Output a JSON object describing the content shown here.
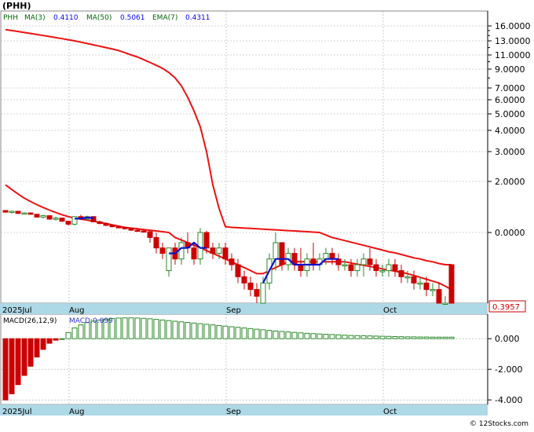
{
  "title": "(PHH)",
  "legend": {
    "symbol": "PHH",
    "items": [
      {
        "label": "MA(3)",
        "value": "0.4110",
        "color": "#0000ff"
      },
      {
        "label": "MA(50)",
        "value": "0.5061",
        "color": "#ff0000"
      },
      {
        "label": "EMA(7)",
        "value": "0.4311",
        "color": "#ff0000"
      }
    ]
  },
  "macd_legend": {
    "label": "MACD(26,12,9)",
    "value_label": "MACD:0.099",
    "value_color": "#3333cc"
  },
  "last_price_badge": "0.3957",
  "watermark": "© 12Stocks.com",
  "colors": {
    "up": "#2a8a2a",
    "down": "#cc0000",
    "ma": "#ee1111",
    "ma_short": "#1111cc",
    "axis_band": "#add8e6",
    "grid": "#aaaaaa"
  },
  "chart_data": [
    {
      "type": "line",
      "panel": "price",
      "scale": "log",
      "y_axis_labels": [
        "16.0000",
        "13.0000",
        "11.0000",
        "9.0000",
        "7.0000",
        "6.0000",
        "5.0000",
        "4.0000",
        "3.0000",
        "2.0000",
        "0.0000"
      ],
      "x_tick_labels": [
        "2025Jul",
        "Aug",
        "Sep",
        "Oct"
      ],
      "x_index_of_ticks": [
        0,
        10,
        35,
        60
      ],
      "n_days": 72,
      "ohlc": [
        [
          0.8,
          0.81,
          0.74,
          0.76
        ],
        [
          0.76,
          0.8,
          0.73,
          0.78
        ],
        [
          0.78,
          0.78,
          0.72,
          0.73
        ],
        [
          0.73,
          0.76,
          0.71,
          0.74
        ],
        [
          0.74,
          0.76,
          0.7,
          0.71
        ],
        [
          0.71,
          0.72,
          0.64,
          0.65
        ],
        [
          0.65,
          0.7,
          0.62,
          0.68
        ],
        [
          0.68,
          0.68,
          0.6,
          0.61
        ],
        [
          0.61,
          0.66,
          0.58,
          0.63
        ],
        [
          0.63,
          0.63,
          0.56,
          0.57
        ],
        [
          0.57,
          0.58,
          0.5,
          0.52
        ],
        [
          0.52,
          0.66,
          0.5,
          0.66
        ],
        [
          0.66,
          0.7,
          0.6,
          0.61
        ],
        [
          0.61,
          0.68,
          0.58,
          0.66
        ],
        [
          0.66,
          0.66,
          0.55,
          0.56
        ],
        [
          0.56,
          0.58,
          0.52,
          0.53
        ],
        [
          0.53,
          0.55,
          0.49,
          0.5
        ],
        [
          0.5,
          0.51,
          0.47,
          0.48
        ],
        [
          0.48,
          0.5,
          0.46,
          0.47
        ],
        [
          0.47,
          0.48,
          0.44,
          0.45
        ],
        [
          0.45,
          0.46,
          0.42,
          0.43
        ],
        [
          0.43,
          0.45,
          0.41,
          0.42
        ],
        [
          0.42,
          0.44,
          0.4,
          0.41
        ],
        [
          0.41,
          0.42,
          0.38,
          0.39
        ],
        [
          0.39,
          0.4,
          0.36,
          0.37
        ],
        [
          0.37,
          0.38,
          0.35,
          0.36
        ],
        [
          0.33,
          0.37,
          0.32,
          0.37
        ],
        [
          0.37,
          0.38,
          0.34,
          0.35
        ],
        [
          0.35,
          0.39,
          0.34,
          0.38
        ],
        [
          0.38,
          0.4,
          0.36,
          0.37
        ],
        [
          0.37,
          0.38,
          0.34,
          0.35
        ],
        [
          0.35,
          0.46,
          0.34,
          0.4
        ],
        [
          0.4,
          0.42,
          0.36,
          0.37
        ],
        [
          0.37,
          0.38,
          0.35,
          0.36
        ],
        [
          0.36,
          0.38,
          0.35,
          0.37
        ],
        [
          0.37,
          0.38,
          0.34,
          0.35
        ],
        [
          0.35,
          0.36,
          0.33,
          0.34
        ],
        [
          0.34,
          0.35,
          0.31,
          0.32
        ],
        [
          0.32,
          0.33,
          0.3,
          0.31
        ],
        [
          0.31,
          0.32,
          0.29,
          0.3
        ],
        [
          0.3,
          0.31,
          0.28,
          0.29
        ],
        [
          0.28,
          0.32,
          0.27,
          0.31
        ],
        [
          0.31,
          0.36,
          0.3,
          0.35
        ],
        [
          0.35,
          0.4,
          0.33,
          0.38
        ],
        [
          0.38,
          0.38,
          0.33,
          0.34
        ],
        [
          0.34,
          0.37,
          0.33,
          0.36
        ],
        [
          0.36,
          0.37,
          0.33,
          0.34
        ],
        [
          0.34,
          0.37,
          0.32,
          0.33
        ],
        [
          0.33,
          0.36,
          0.32,
          0.35
        ],
        [
          0.35,
          0.38,
          0.33,
          0.34
        ],
        [
          0.34,
          0.36,
          0.33,
          0.35
        ],
        [
          0.35,
          0.37,
          0.34,
          0.36
        ],
        [
          0.36,
          0.37,
          0.34,
          0.35
        ],
        [
          0.35,
          0.36,
          0.33,
          0.34
        ],
        [
          0.34,
          0.35,
          0.33,
          0.34
        ],
        [
          0.34,
          0.35,
          0.32,
          0.33
        ],
        [
          0.33,
          0.35,
          0.32,
          0.34
        ],
        [
          0.34,
          0.36,
          0.32,
          0.35
        ],
        [
          0.35,
          0.37,
          0.33,
          0.34
        ],
        [
          0.34,
          0.35,
          0.32,
          0.33
        ],
        [
          0.33,
          0.34,
          0.32,
          0.33
        ],
        [
          0.33,
          0.35,
          0.32,
          0.34
        ],
        [
          0.34,
          0.35,
          0.32,
          0.33
        ],
        [
          0.33,
          0.34,
          0.31,
          0.32
        ],
        [
          0.32,
          0.33,
          0.31,
          0.32
        ],
        [
          0.32,
          0.33,
          0.3,
          0.31
        ],
        [
          0.31,
          0.32,
          0.3,
          0.31
        ],
        [
          0.31,
          0.32,
          0.29,
          0.3
        ],
        [
          0.3,
          0.31,
          0.29,
          0.3
        ],
        [
          0.3,
          0.31,
          0.28,
          0.28
        ],
        [
          0.27,
          0.29,
          0.27,
          0.28
        ],
        [
          0.34,
          0.34,
          0.27,
          0.28
        ]
      ],
      "series": [
        {
          "name": "MA(50)",
          "color": "#ee1111",
          "values": [
            15.2,
            15.0,
            14.8,
            14.6,
            14.4,
            14.2,
            14.0,
            13.8,
            13.6,
            13.4,
            13.2,
            13.0,
            12.8,
            12.6,
            12.4,
            12.2,
            12.0,
            11.8,
            11.6,
            11.3,
            11.0,
            10.7,
            10.3,
            9.9,
            9.5,
            9.1,
            8.6,
            8.0,
            7.2,
            6.2,
            5.2,
            4.2,
            3.0,
            1.8,
            0.85,
            0.48,
            0.47,
            0.465,
            0.46,
            0.455,
            0.45,
            0.445,
            0.44,
            0.435,
            0.43,
            0.425,
            0.42,
            0.415,
            0.41,
            0.405,
            0.4,
            0.395,
            0.39,
            0.387,
            0.384,
            0.381,
            0.378,
            0.375,
            0.372,
            0.369,
            0.366,
            0.363,
            0.361,
            0.358,
            0.355,
            0.352,
            0.35,
            0.347,
            0.345,
            0.342,
            0.34,
            0.34
          ]
        },
        {
          "name": "EMA(7)",
          "color": "#ee1111",
          "values": [
            1.8,
            1.55,
            1.35,
            1.18,
            1.06,
            0.96,
            0.88,
            0.81,
            0.75,
            0.7,
            0.66,
            0.63,
            0.61,
            0.59,
            0.57,
            0.55,
            0.53,
            0.51,
            0.49,
            0.47,
            0.46,
            0.45,
            0.44,
            0.43,
            0.42,
            0.41,
            0.4,
            0.39,
            0.385,
            0.38,
            0.375,
            0.37,
            0.365,
            0.36,
            0.355,
            0.35,
            0.345,
            0.34,
            0.335,
            0.33,
            0.325,
            0.325,
            0.33,
            0.335,
            0.34,
            0.345,
            0.345,
            0.345,
            0.345,
            0.345,
            0.345,
            0.345,
            0.345,
            0.345,
            0.345,
            0.343,
            0.341,
            0.339,
            0.337,
            0.335,
            0.333,
            0.331,
            0.329,
            0.327,
            0.325,
            0.322,
            0.319,
            0.316,
            0.313,
            0.31,
            0.305,
            0.3
          ]
        },
        {
          "name": "MA(3)",
          "color": "#1111cc",
          "points_index": [
            11,
            12,
            13,
            14
          ],
          "values_blue": [
            0.62,
            0.62,
            0.64,
            0.63
          ]
        }
      ],
      "ma3_segments": [
        {
          "start": 11,
          "values": [
            0.62,
            0.62,
            0.64,
            0.63
          ]
        },
        {
          "start": 26,
          "values": [
            0.36,
            0.36,
            0.37,
            0.37,
            0.38,
            0.37,
            0.37
          ]
        },
        {
          "start": 41,
          "values": [
            0.31,
            0.33,
            0.35,
            0.35,
            0.35,
            0.34,
            0.34,
            0.34,
            0.34,
            0.34,
            0.35,
            0.35,
            0.35
          ]
        }
      ]
    },
    {
      "type": "bar",
      "panel": "macd",
      "y_axis_labels": [
        "0.000",
        "-2.000",
        "-4.000"
      ],
      "ylim": [
        -4.3,
        1.6
      ],
      "x_tick_labels": [
        "2025Jul",
        "Aug",
        "Sep",
        "Oct"
      ],
      "values": [
        -4.0,
        -3.6,
        -3.0,
        -2.4,
        -1.8,
        -1.2,
        -0.7,
        -0.3,
        -0.1,
        0.0,
        0.4,
        0.7,
        0.9,
        1.05,
        1.15,
        1.22,
        1.28,
        1.32,
        1.35,
        1.36,
        1.36,
        1.35,
        1.33,
        1.3,
        1.26,
        1.22,
        1.18,
        1.14,
        1.1,
        1.06,
        1.02,
        0.98,
        0.94,
        0.9,
        0.86,
        0.82,
        0.78,
        0.74,
        0.7,
        0.66,
        0.62,
        0.58,
        0.54,
        0.5,
        0.47,
        0.44,
        0.41,
        0.38,
        0.35,
        0.33,
        0.31,
        0.29,
        0.27,
        0.25,
        0.23,
        0.21,
        0.2,
        0.19,
        0.18,
        0.17,
        0.16,
        0.15,
        0.14,
        0.13,
        0.12,
        0.12,
        0.11,
        0.11,
        0.1,
        0.1,
        0.1,
        0.099
      ]
    }
  ]
}
